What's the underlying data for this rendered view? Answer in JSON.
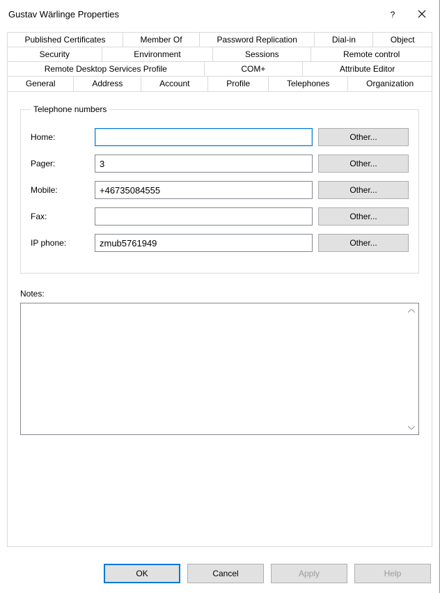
{
  "title": "Gustav Wärlinge Properties",
  "tabs": {
    "row1": [
      "Published Certificates",
      "Member Of",
      "Password Replication",
      "Dial-in",
      "Object"
    ],
    "row2": [
      "Security",
      "Environment",
      "Sessions",
      "Remote control"
    ],
    "row3": [
      "Remote Desktop Services Profile",
      "COM+",
      "Attribute Editor"
    ],
    "row4": [
      "General",
      "Address",
      "Account",
      "Profile",
      "Telephones",
      "Organization"
    ],
    "active": "Telephones"
  },
  "group": {
    "legend": "Telephone numbers",
    "rows": [
      {
        "label": "Home:",
        "value": "",
        "other": "Other..."
      },
      {
        "label": "Pager:",
        "value": "3",
        "other": "Other..."
      },
      {
        "label": "Mobile:",
        "value": "+46735084555",
        "other": "Other..."
      },
      {
        "label": "Fax:",
        "value": "",
        "other": "Other..."
      },
      {
        "label": "IP phone:",
        "value": "zmub5761949",
        "other": "Other..."
      }
    ]
  },
  "notes": {
    "label": "Notes:",
    "value": ""
  },
  "buttons": {
    "ok": "OK",
    "cancel": "Cancel",
    "apply": "Apply",
    "help": "Help"
  }
}
